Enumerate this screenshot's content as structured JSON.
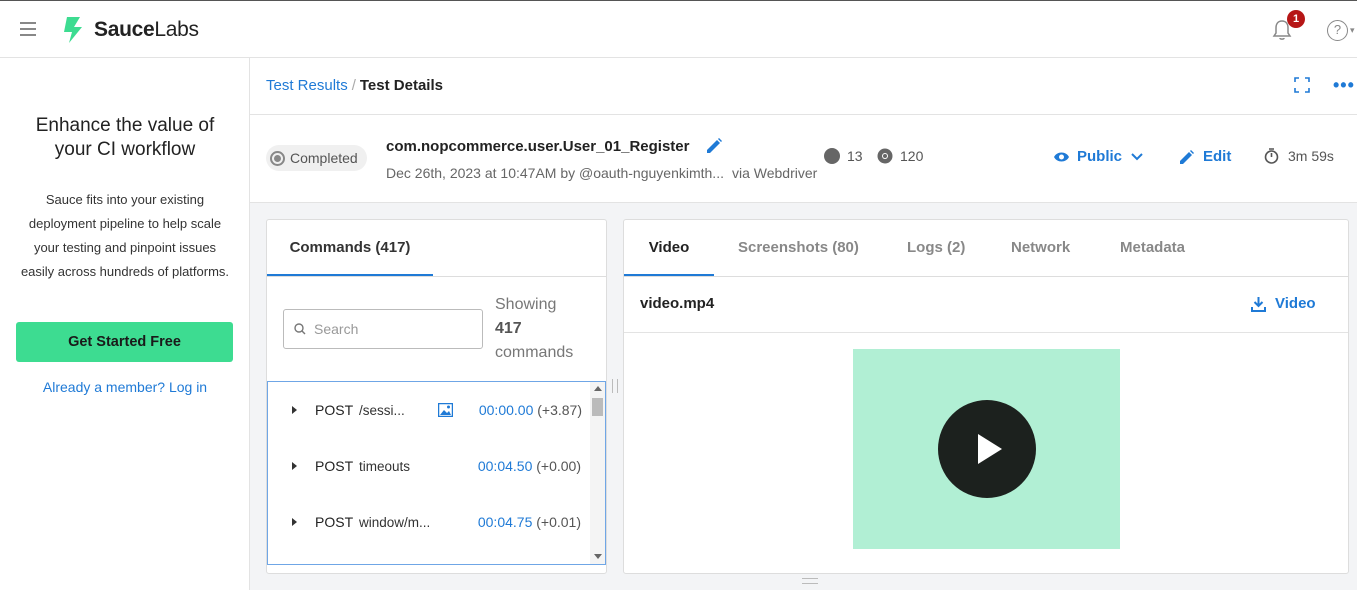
{
  "header": {
    "logo_text_bold": "Sauce",
    "logo_text": "Labs",
    "notification_count": "1",
    "help_glyph": "?"
  },
  "sidebar": {
    "promo_title": "Enhance the value of your CI workflow",
    "promo_body": "Sauce fits into your existing deployment pipeline to help scale your testing and pinpoint issues easily across hundreds of platforms.",
    "cta_label": "Get Started Free",
    "login_text": "Already a member? Log in"
  },
  "breadcrumb": {
    "parent": "Test Results",
    "separator": "/",
    "current": "Test Details"
  },
  "test": {
    "status": "Completed",
    "name": "com.nopcommerce.user.User_01_Register",
    "date_by": "Dec 26th, 2023 at 10:47AM by @oauth-nguyenkimth...",
    "via": "via Webdriver",
    "os_version": "13",
    "browser_version": "120",
    "visibility": "Public",
    "edit_label": "Edit",
    "duration": "3m 59s"
  },
  "commands": {
    "tab_label": "Commands (417)",
    "search_placeholder": "Search",
    "showing_label": "Showing",
    "showing_count": "417",
    "showing_unit": "commands",
    "rows": [
      {
        "method": "POST",
        "path": "/sessi...",
        "time": "00:00.00",
        "delta": "(+3.87)",
        "has_screenshot": true
      },
      {
        "method": "POST",
        "path": "timeouts",
        "time": "00:04.50",
        "delta": "(+0.00)",
        "has_screenshot": false
      },
      {
        "method": "POST",
        "path": "window/m...",
        "time": "00:04.75",
        "delta": "(+0.01)",
        "has_screenshot": false
      }
    ]
  },
  "media": {
    "tabs": [
      "Video",
      "Screenshots (80)",
      "Logs (2)",
      "Network",
      "Metadata"
    ],
    "active_tab": "Video",
    "file_name": "video.mp4",
    "download_label": "Video"
  },
  "colors": {
    "accent": "#1f7ad6",
    "cta": "#3ddc91",
    "video_bg": "#b1efd4",
    "badge": "#b61616"
  }
}
